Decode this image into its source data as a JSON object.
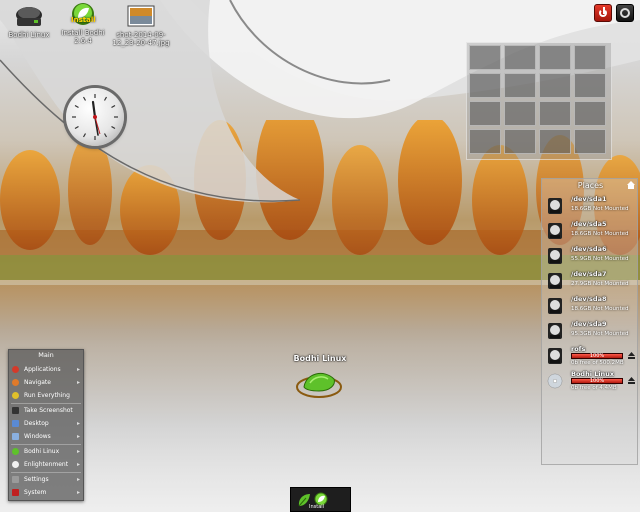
{
  "desktop_icons": [
    {
      "label": "Bodhi Linux",
      "icon": "drive-icon"
    },
    {
      "label": "Install Bodhi 2.6.4",
      "icon": "install-bodhi-icon",
      "badge": "Install"
    },
    {
      "label": "shot-2014-09-12_23-20-47.jpg",
      "icon": "image-file-icon"
    }
  ],
  "pager": {
    "rows": 4,
    "cols": 4
  },
  "places": {
    "title": "Places",
    "items": [
      {
        "name": "/dev/sda1",
        "status": "18.6GB Not Mounted"
      },
      {
        "name": "/dev/sda5",
        "status": "18.6GB Not Mounted"
      },
      {
        "name": "/dev/sda6",
        "status": "55.9GB Not Mounted"
      },
      {
        "name": "/dev/sda7",
        "status": "27.9GB Not Mounted"
      },
      {
        "name": "/dev/sda8",
        "status": "18.6GB Not Mounted"
      },
      {
        "name": "/dev/sda9",
        "status": "95.3GB Not Mounted"
      },
      {
        "name": "rofs",
        "status": "0b free of 500.2MB",
        "usage_percent": 100,
        "usage_label": "100%"
      },
      {
        "name": "Bodhi Linux",
        "status": "0b free of 4.4MB",
        "usage_percent": 100,
        "usage_label": "100%"
      }
    ]
  },
  "main_menu": {
    "title": "Main",
    "items": [
      {
        "label": "Applications",
        "icon": "applications-icon",
        "submenu": true
      },
      {
        "label": "Navigate",
        "icon": "navigate-icon",
        "submenu": true
      },
      {
        "label": "Run Everything",
        "icon": "run-icon",
        "submenu": false
      },
      {
        "label": "Take Screenshot",
        "icon": "screenshot-icon",
        "submenu": false
      },
      {
        "label": "Desktop",
        "icon": "desktop-icon",
        "submenu": true
      },
      {
        "label": "Windows",
        "icon": "windows-icon",
        "submenu": true
      },
      {
        "label": "Bodhi Linux",
        "icon": "bodhi-icon",
        "submenu": true
      },
      {
        "label": "Enlightenment",
        "icon": "enlightenment-icon",
        "submenu": true
      },
      {
        "label": "Settings",
        "icon": "settings-icon",
        "submenu": true
      },
      {
        "label": "System",
        "icon": "system-icon",
        "submenu": true
      }
    ]
  },
  "center_logo": {
    "label": "Bodhi Linux"
  },
  "taskbar": {
    "install_label": "Install"
  },
  "colors": {
    "accent_green": "#5ec12a",
    "power_red": "#d42a1a",
    "usage_red": "#c8281a"
  }
}
